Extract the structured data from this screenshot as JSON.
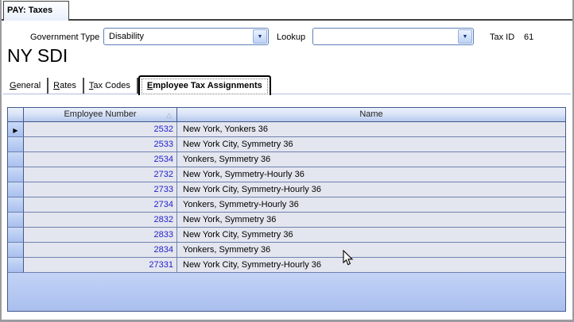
{
  "window": {
    "title_tab": "PAY: Taxes"
  },
  "toolbar": {
    "government_type": {
      "label": "Government Type",
      "value": "Disability"
    },
    "lookup": {
      "label": "Lookup",
      "value": ""
    },
    "tax_id": {
      "label": "Tax ID",
      "value": "61"
    }
  },
  "page_title": "NY SDI",
  "tabs": [
    {
      "label": "General",
      "hotkey": "G",
      "rest": "eneral",
      "active": false
    },
    {
      "label": "Rates",
      "hotkey": "R",
      "rest": "ates",
      "active": false
    },
    {
      "label": "Tax Codes",
      "hotkey": "T",
      "rest": "ax Codes",
      "active": false
    },
    {
      "label": "Employee Tax Assignments",
      "hotkey": "E",
      "rest": "mployee Tax Assignments",
      "active": true
    }
  ],
  "grid": {
    "columns": {
      "employee_number": "Employee Number",
      "name": "Name"
    },
    "sort": {
      "column": "Employee Number",
      "direction": "ascending",
      "icon": "△"
    },
    "current_row_marker": "▶",
    "rows": [
      {
        "employee_number": "2532",
        "name": "New York, Yonkers 36",
        "current": true
      },
      {
        "employee_number": "2533",
        "name": "New York City, Symmetry 36",
        "current": false
      },
      {
        "employee_number": "2534",
        "name": "Yonkers, Symmetry 36",
        "current": false
      },
      {
        "employee_number": "2732",
        "name": "New York, Symmetry-Hourly 36",
        "current": false
      },
      {
        "employee_number": "2733",
        "name": "New York City, Symmetry-Hourly 36",
        "current": false
      },
      {
        "employee_number": "2734",
        "name": "Yonkers, Symmetry-Hourly 36",
        "current": false
      },
      {
        "employee_number": "2832",
        "name": "New York, Symmetry 36",
        "current": false
      },
      {
        "employee_number": "2833",
        "name": "New York City, Symmetry 36",
        "current": false
      },
      {
        "employee_number": "2834",
        "name": "Yonkers, Symmetry 36",
        "current": false
      },
      {
        "employee_number": "27331",
        "name": "New York City, Symmetry-Hourly 36",
        "current": false
      }
    ]
  },
  "icons": {
    "dropdown_arrow": "▼"
  },
  "colors": {
    "grid_border": "#44588c",
    "grid_line": "#6d81ad",
    "header_gradient_top": "#eaf0fc",
    "header_gradient_bottom": "#b5c8ee",
    "row_selector_top": "#cadaf7",
    "row_selector_bottom": "#a9c0ee",
    "cell_background": "#e4e6ef",
    "empty_area": "#b7c9f1",
    "employee_number_text": "#2222cc",
    "combo_border": "#5d80b6",
    "tab_baseline": "#aebcdd",
    "window_border": "#9b9ba1"
  }
}
